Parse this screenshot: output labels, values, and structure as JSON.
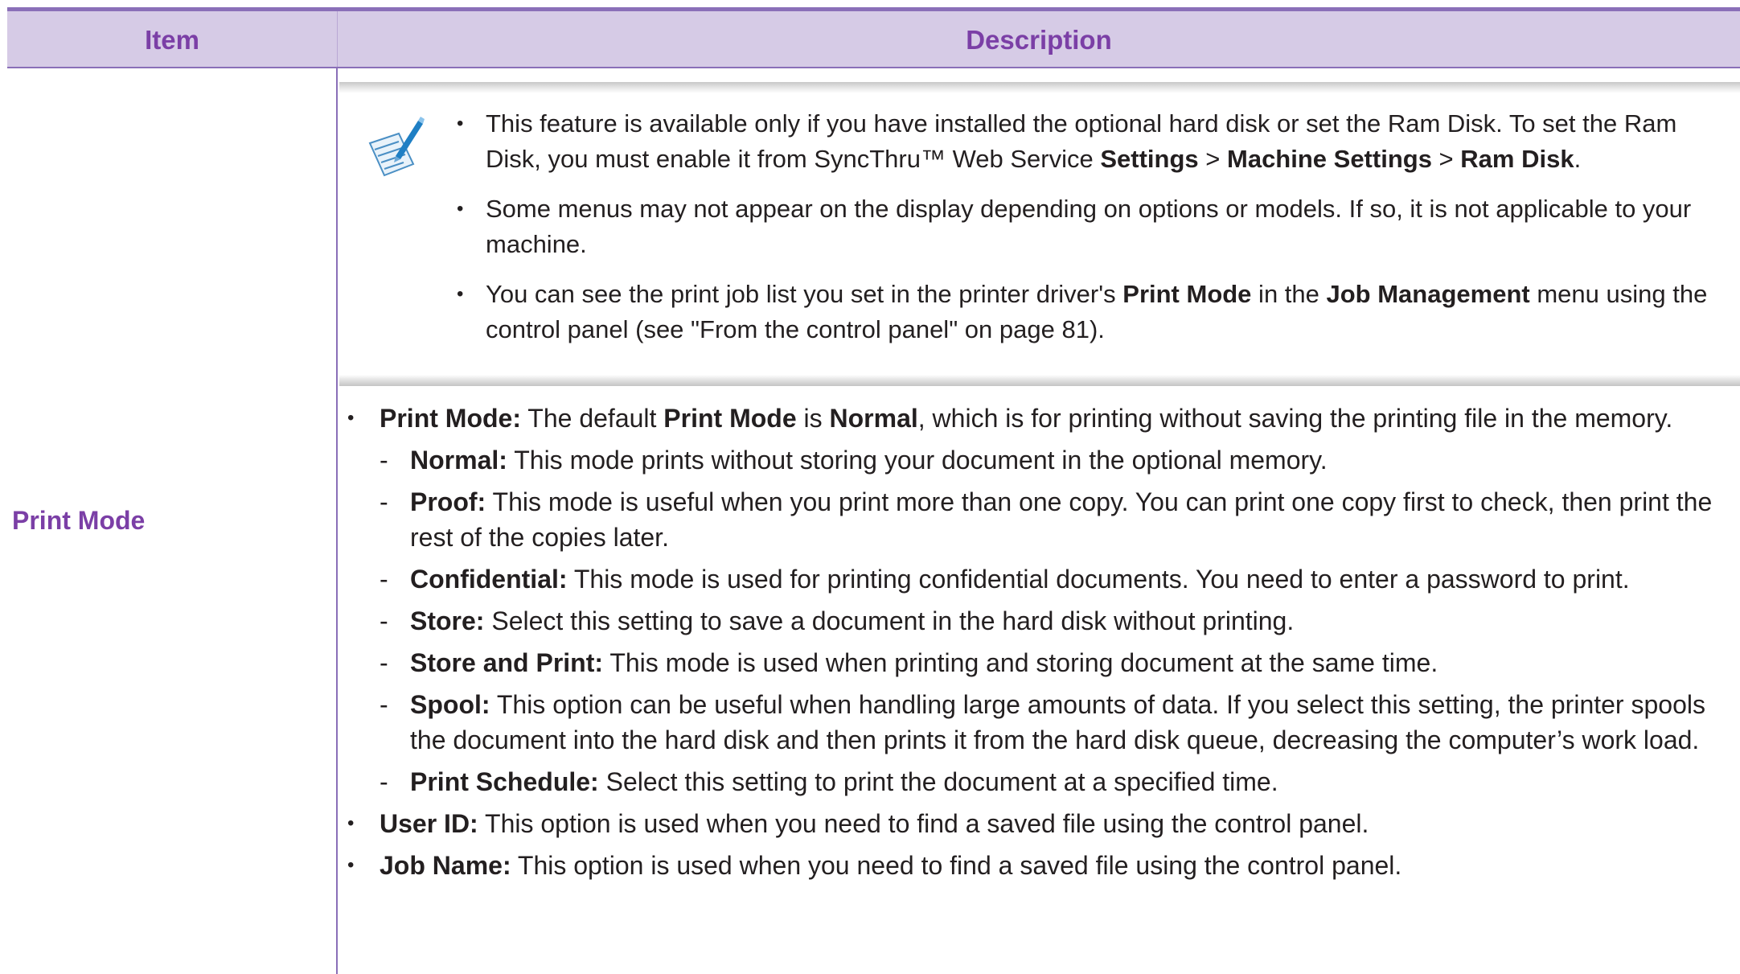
{
  "header": {
    "item": "Item",
    "description": "Description"
  },
  "row": {
    "item": "Print Mode",
    "note": {
      "icon": "note-pen-icon",
      "items": [
        {
          "parts": [
            {
              "t": " This feature is available only if you have installed the optional hard disk or set the Ram Disk. To set the Ram Disk, you must enable it from SyncThru™ Web Service "
            },
            {
              "t": "Settings",
              "b": true
            },
            {
              "t": " > "
            },
            {
              "t": "Machine Settings",
              "b": true
            },
            {
              "t": " > "
            },
            {
              "t": "Ram Disk",
              "b": true
            },
            {
              "t": "."
            }
          ]
        },
        {
          "parts": [
            {
              "t": "Some menus may not appear on the display depending on options or models. If so, it is not applicable to your machine."
            }
          ]
        },
        {
          "parts": [
            {
              "t": "You can see the print job list you set in the printer driver's "
            },
            {
              "t": "Print Mode",
              "b": true
            },
            {
              "t": " in the "
            },
            {
              "t": "Job Management",
              "b": true
            },
            {
              "t": " menu using the control panel (see \"From the control panel\" on page 81)."
            }
          ]
        }
      ]
    },
    "description": [
      {
        "kind": "bullet",
        "parts": [
          {
            "t": "Print Mode:",
            "b": true
          },
          {
            "t": " The default "
          },
          {
            "t": "Print Mode",
            "b": true
          },
          {
            "t": " is "
          },
          {
            "t": "Normal",
            "b": true
          },
          {
            "t": ", which is for printing without saving the printing file in the memory."
          }
        ]
      },
      {
        "kind": "sub",
        "parts": [
          {
            "t": "Normal:",
            "b": true
          },
          {
            "t": " This mode prints without storing your document in the optional memory."
          }
        ]
      },
      {
        "kind": "sub",
        "parts": [
          {
            "t": "Proof:",
            "b": true
          },
          {
            "t": " This mode is useful when you print more than one copy. You can print one copy first to check, then print the rest of the copies later."
          }
        ]
      },
      {
        "kind": "sub",
        "parts": [
          {
            "t": "Confidential:",
            "b": true
          },
          {
            "t": " This mode is used for printing confidential documents. You need to enter a password to print."
          }
        ]
      },
      {
        "kind": "sub",
        "parts": [
          {
            "t": "Store:",
            "b": true
          },
          {
            "t": " Select this setting to save a document in the hard disk without printing."
          }
        ]
      },
      {
        "kind": "sub",
        "parts": [
          {
            "t": "Store and Print:",
            "b": true
          },
          {
            "t": " This mode is used when printing and storing document at the same time."
          }
        ]
      },
      {
        "kind": "sub",
        "parts": [
          {
            "t": "Spool:",
            "b": true
          },
          {
            "t": " This option can be useful when handling large amounts of data. If you select this setting, the printer spools the document into the hard disk and then prints it from the hard disk queue, decreasing the computer’s work load."
          }
        ]
      },
      {
        "kind": "sub",
        "parts": [
          {
            "t": "Print Schedule:",
            "b": true
          },
          {
            "t": " Select this setting to print the document at a specified time."
          }
        ]
      },
      {
        "kind": "bullet",
        "parts": [
          {
            "t": "User ID:",
            "b": true
          },
          {
            "t": " This option is used when you need to find a saved file using the control panel."
          }
        ]
      },
      {
        "kind": "bullet",
        "parts": [
          {
            "t": "Job Name:",
            "b": true
          },
          {
            "t": " This option is used when you need to find a saved file using the control panel."
          }
        ]
      }
    ]
  }
}
